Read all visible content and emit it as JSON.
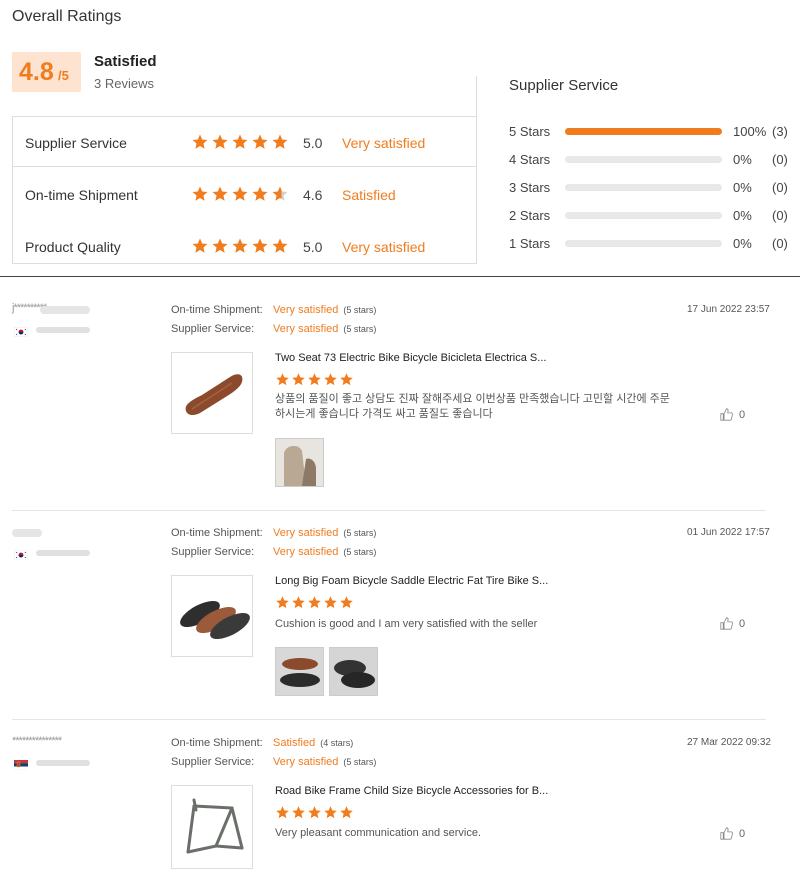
{
  "header": {
    "title": "Overall Ratings",
    "score_big": "4.8",
    "score_small": "/5",
    "overall_label": "Satisfied",
    "review_count": "3 Reviews"
  },
  "metrics": [
    {
      "name": "Supplier Service",
      "value": "5.0",
      "verdict": "Very satisfied",
      "rating": 5.0
    },
    {
      "name": "On-time Shipment",
      "value": "4.6",
      "verdict": "Satisfied",
      "rating": 4.6
    },
    {
      "name": "Product Quality",
      "value": "5.0",
      "verdict": "Very satisfied",
      "rating": 5.0
    }
  ],
  "breakdown": {
    "title": "Supplier Service",
    "rows": [
      {
        "label": "5  Stars",
        "fraction": 1.0,
        "pct": "100%",
        "count": "(3)"
      },
      {
        "label": "4  Stars",
        "fraction": 0.0,
        "pct": "0%",
        "count": "(0)"
      },
      {
        "label": "3  Stars",
        "fraction": 0.0,
        "pct": "0%",
        "count": "(0)"
      },
      {
        "label": "2  Stars",
        "fraction": 0.0,
        "pct": "0%",
        "count": "(0)"
      },
      {
        "label": "1  Stars",
        "fraction": 0.0,
        "pct": "0%",
        "count": "(0)"
      }
    ]
  },
  "reviews": [
    {
      "user": "j**********",
      "date": "17 Jun 2022 23:57",
      "shipment_label": "On-time Shipment:",
      "shipment_verdict": "Very satisfied",
      "shipment_stars": "(5 stars)",
      "service_label": "Supplier Service:",
      "service_verdict": "Very satisfied",
      "service_stars": "(5 stars)",
      "product_title": "Two Seat 73 Electric Bike Bicycle Bicicleta Electrica S...",
      "rating": 5,
      "text": "상품의 품질이 좋고 상담도 진짜 잘해주세요 이번상품 만족했습니다 고민할 시간에 주문하시는게 좋습니다 가격도 싸고 품질도 좋습니다",
      "likes": "0",
      "flag_color": "kr"
    },
    {
      "user": "",
      "date": "01 Jun 2022 17:57",
      "shipment_label": "On-time Shipment:",
      "shipment_verdict": "Very satisfied",
      "shipment_stars": "(5 stars)",
      "service_label": "Supplier Service:",
      "service_verdict": "Very satisfied",
      "service_stars": "(5 stars)",
      "product_title": "Long Big Foam Bicycle Saddle Electric Fat Tire Bike S...",
      "rating": 5,
      "text": "Cushion is good and I am very satisfied with the seller",
      "likes": "0",
      "flag_color": "kr"
    },
    {
      "user": "***************",
      "date": "27 Mar 2022 09:32",
      "shipment_label": "On-time Shipment:",
      "shipment_verdict": "Satisfied",
      "shipment_stars": "(4 stars)",
      "service_label": "Supplier Service:",
      "service_verdict": "Very satisfied",
      "service_stars": "(5 stars)",
      "product_title": "Road Bike Frame Child Size Bicycle Accessories for B...",
      "rating": 5,
      "text": "Very pleasant communication and service.",
      "likes": "0",
      "flag_color": "rs"
    }
  ],
  "colors": {
    "accent": "#f07c1e",
    "score_bg": "#fde3d0",
    "track": "#e8e8e8"
  },
  "icons": {
    "star": "star-icon",
    "like": "thumbs-up-icon",
    "flag": "country-flag-icon"
  }
}
